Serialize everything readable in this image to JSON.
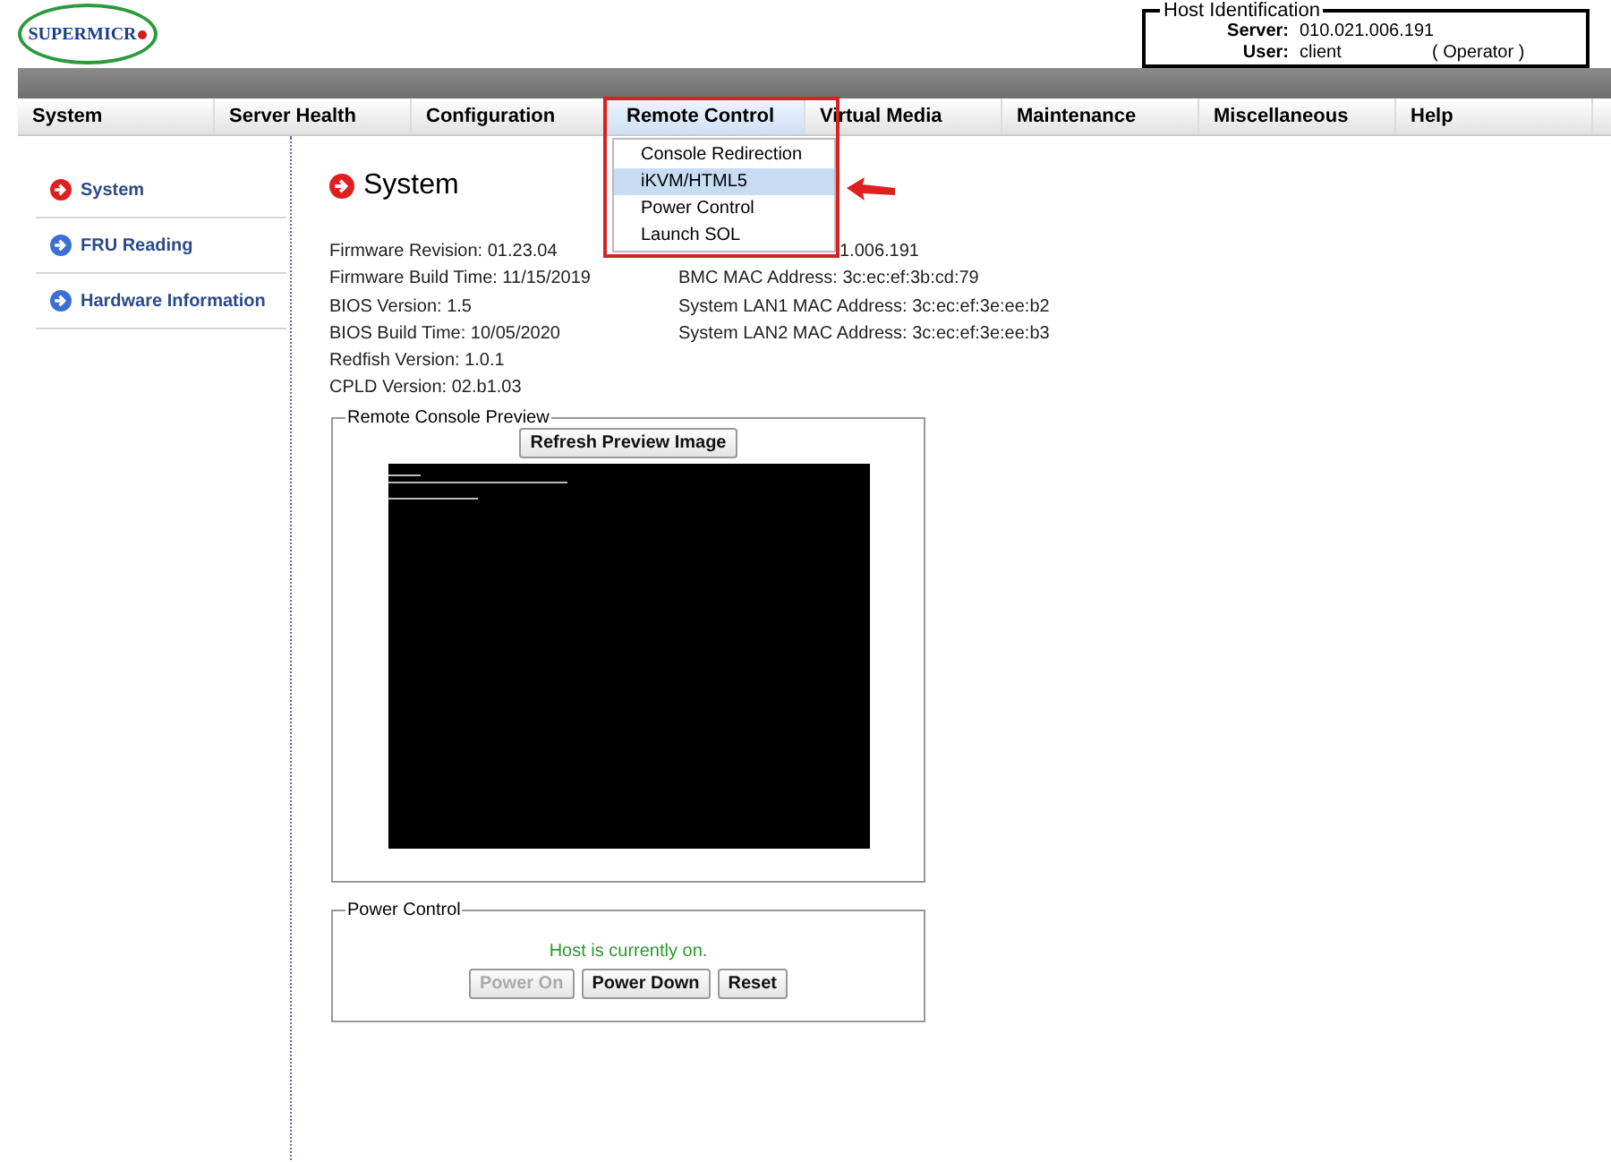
{
  "logo": {
    "text": "SUPERMICR"
  },
  "host_identification": {
    "title": "Host Identification",
    "fields": [
      {
        "label": "Server:",
        "value": "010.021.006.191"
      },
      {
        "label": "User:",
        "value": "client",
        "role": "( Operator )"
      }
    ]
  },
  "nav_tabs": [
    {
      "label": "System",
      "selected": false
    },
    {
      "label": "Server Health",
      "selected": false
    },
    {
      "label": "Configuration",
      "selected": false
    },
    {
      "label": "Remote Control",
      "selected": true
    },
    {
      "label": "Virtual Media",
      "selected": false
    },
    {
      "label": "Maintenance",
      "selected": false
    },
    {
      "label": "Miscellaneous",
      "selected": false
    },
    {
      "label": "Help",
      "selected": false
    }
  ],
  "dropdown": {
    "items": [
      {
        "label": "Console Redirection",
        "selected": false
      },
      {
        "label": "iKVM/HTML5",
        "selected": true
      },
      {
        "label": "Power Control",
        "selected": false
      },
      {
        "label": "Launch SOL",
        "selected": false
      }
    ]
  },
  "sidebar": {
    "items": [
      {
        "label": "System",
        "selected": true
      },
      {
        "label": "FRU Reading",
        "selected": false
      },
      {
        "label": "Hardware Information",
        "selected": false
      }
    ]
  },
  "page_title": "System",
  "info_left": [
    "Firmware Revision: 01.23.04",
    "Firmware Build Time: 11/15/2019",
    "BIOS Version: 1.5",
    "BIOS Build Time: 10/05/2020",
    "Redfish Version: 1.0.1",
    "CPLD Version: 02.b1.03"
  ],
  "info_right_partial": "1.006.191",
  "info_right": [
    "BMC MAC Address: 3c:ec:ef:3b:cd:79",
    "System LAN1 MAC Address: 3c:ec:ef:3e:ee:b2",
    "System LAN2 MAC Address: 3c:ec:ef:3e:ee:b3"
  ],
  "console_preview": {
    "title": "Remote Console Preview",
    "button": "Refresh Preview Image"
  },
  "power_control": {
    "title": "Power Control",
    "status": "Host is currently on.",
    "buttons": [
      {
        "label": "Power On",
        "disabled": true
      },
      {
        "label": "Power Down",
        "disabled": false
      },
      {
        "label": "Reset",
        "disabled": false
      }
    ]
  }
}
